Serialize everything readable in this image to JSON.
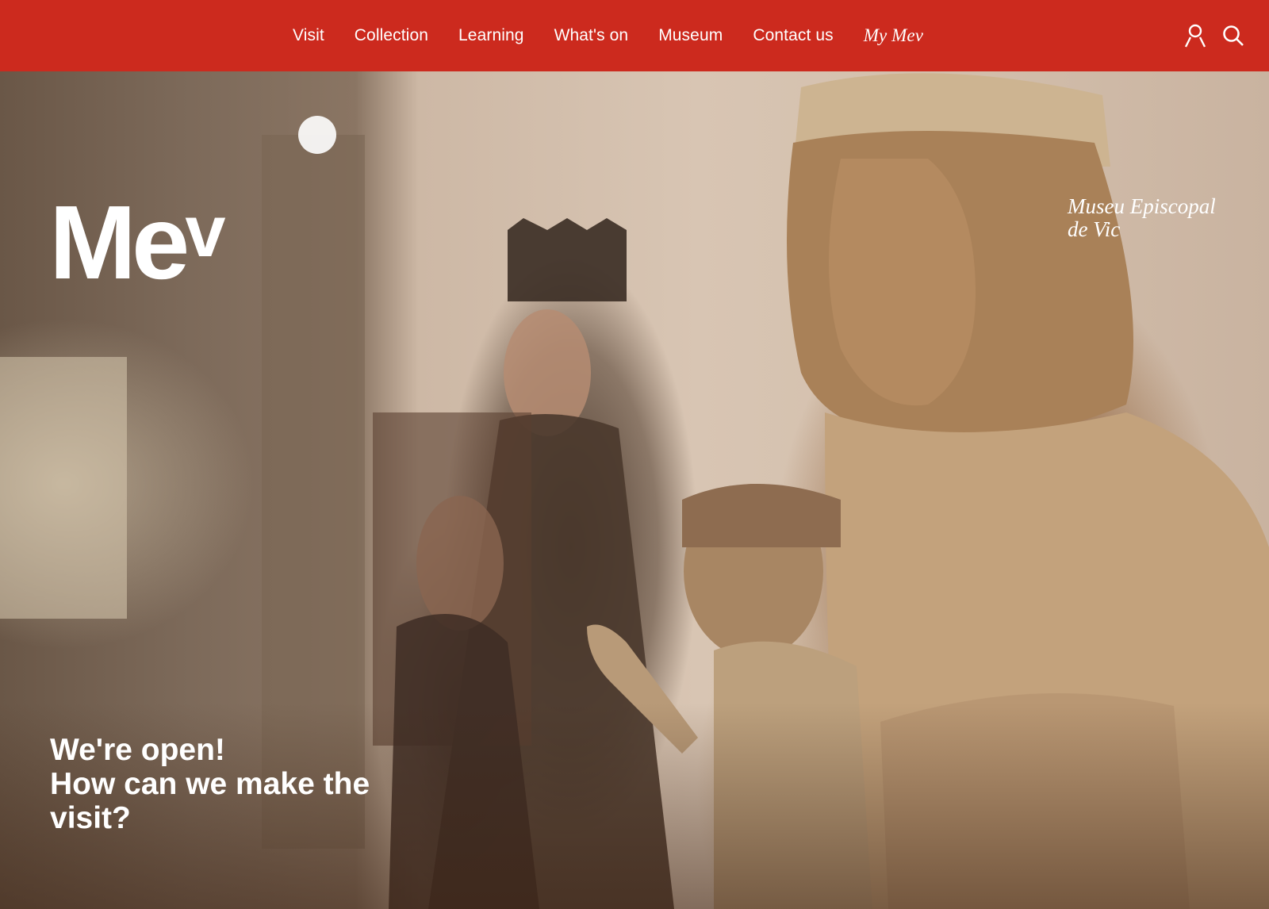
{
  "nav": {
    "items": [
      {
        "label": "Visit"
      },
      {
        "label": "Collection"
      },
      {
        "label": "Learning"
      },
      {
        "label": "What's on"
      },
      {
        "label": "Museum"
      },
      {
        "label": "Contact us"
      }
    ],
    "my_mev": "My Mev",
    "icons": [
      "user-icon",
      "search-icon"
    ],
    "background": "#cc2a1e"
  },
  "hero": {
    "logo_main": "Me",
    "logo_v": "v",
    "museum_name_line1": "Museu Episcopal",
    "museum_name_line2": "de Vic",
    "headline_line1": "We're open!",
    "headline_line2": "How can we make the",
    "headline_line3": "visit?"
  }
}
